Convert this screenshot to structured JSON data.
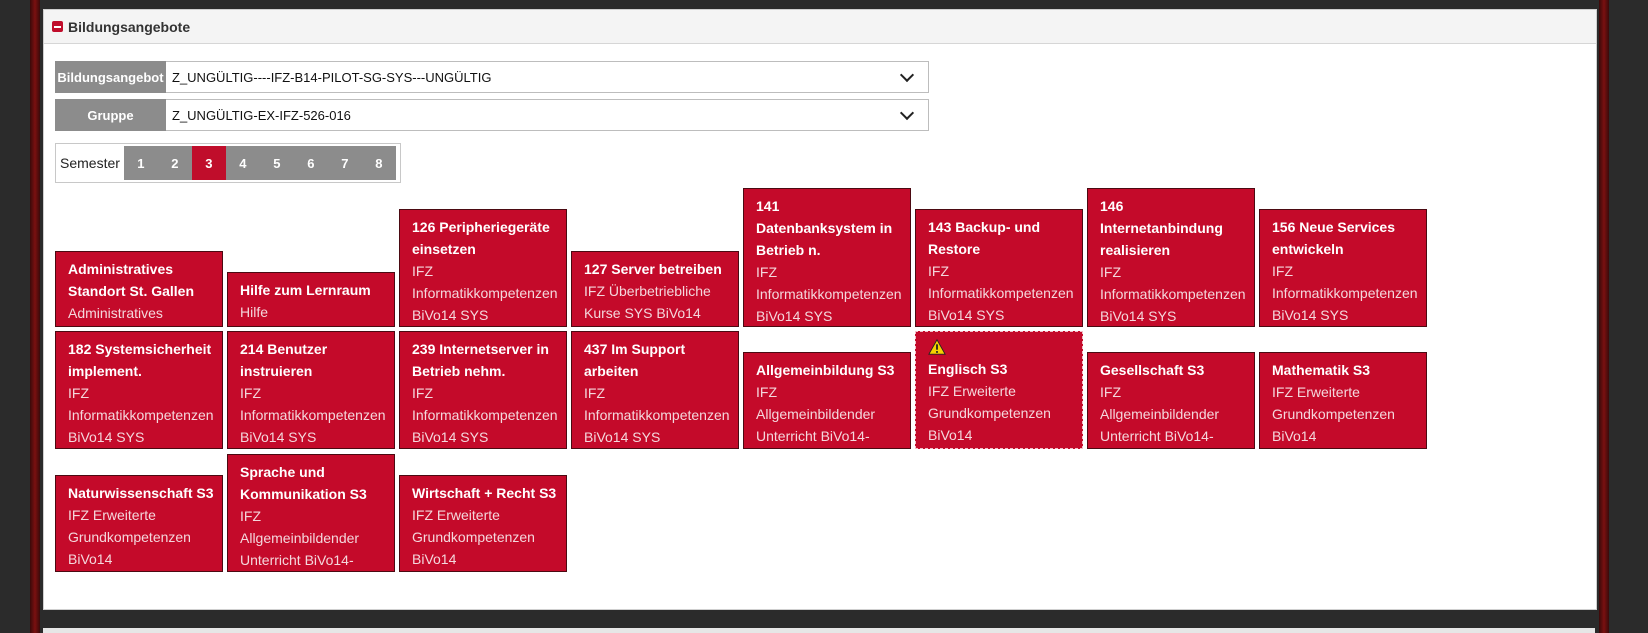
{
  "section": {
    "title": "Bildungsangebote"
  },
  "fields": {
    "bildungsangebot": {
      "label": "Bildungsangebot",
      "value": "Z_UNGÜLTIG----IFZ-B14-PILOT-SG-SYS---UNGÜLTIG"
    },
    "gruppe": {
      "label": "Gruppe",
      "value": "Z_UNGÜLTIG-EX-IFZ-526-016"
    }
  },
  "semester": {
    "label": "Semester",
    "options": [
      "1",
      "2",
      "3",
      "4",
      "5",
      "6",
      "7",
      "8"
    ],
    "active": "3"
  },
  "tiles": [
    {
      "title": "Administratives\nStandort St. Gallen",
      "sub": "Administratives"
    },
    {
      "title": "Hilfe zum Lernraum",
      "sub": "Hilfe"
    },
    {
      "title": "126 Peripheriegeräte\neinsetzen",
      "sub": "IFZ\nInformatikkompetenzen\nBiVo14 SYS"
    },
    {
      "title": "127 Server betreiben",
      "sub": "IFZ Überbetriebliche\nKurse SYS BiVo14"
    },
    {
      "title": "141\nDatenbanksystem in\nBetrieb n.",
      "sub": "IFZ\nInformatikkompetenzen\nBiVo14 SYS"
    },
    {
      "title": "143 Backup- und\nRestore",
      "sub": "IFZ\nInformatikkompetenzen\nBiVo14 SYS"
    },
    {
      "title": "146\nInternetanbindung\nrealisieren",
      "sub": "IFZ\nInformatikkompetenzen\nBiVo14 SYS"
    },
    {
      "title": "156 Neue Services\nentwickeln",
      "sub": "IFZ\nInformatikkompetenzen\nBiVo14 SYS"
    },
    {
      "title": "182 Systemsicherheit\nimplement.",
      "sub": "IFZ\nInformatikkompetenzen\nBiVo14 SYS"
    },
    {
      "title": "214 Benutzer\ninstruieren",
      "sub": "IFZ\nInformatikkompetenzen\nBiVo14 SYS"
    },
    {
      "title": "239 Internetserver in\nBetrieb nehm.",
      "sub": "IFZ\nInformatikkompetenzen\nBiVo14 SYS"
    },
    {
      "title": "437 Im Support\narbeiten",
      "sub": "IFZ\nInformatikkompetenzen\nBiVo14 SYS"
    },
    {
      "title": "Allgemeinbildung S3",
      "sub": "IFZ\nAllgemeinbildender\nUnterricht BiVo14-"
    },
    {
      "title": "Englisch S3",
      "sub": "IFZ Erweiterte\nGrundkompetenzen\nBiVo14",
      "warning": true
    },
    {
      "title": "Gesellschaft S3",
      "sub": "IFZ\nAllgemeinbildender\nUnterricht BiVo14-"
    },
    {
      "title": "Mathematik S3",
      "sub": "IFZ Erweiterte\nGrundkompetenzen\nBiVo14"
    },
    {
      "title": "Naturwissenschaft S3",
      "sub": "IFZ Erweiterte\nGrundkompetenzen\nBiVo14"
    },
    {
      "title": "Sprache und\nKommunikation S3",
      "sub": "IFZ\nAllgemeinbildender\nUnterricht BiVo14-"
    },
    {
      "title": "Wirtschaft + Recht S3",
      "sub": "IFZ Erweiterte\nGrundkompetenzen\nBiVo14"
    }
  ],
  "colors": {
    "tile_red": "#c40a2a",
    "active_semester": "#c00d2b",
    "label_gray": "#8c8c8c"
  },
  "icons": {
    "collapse": "minus-square-icon",
    "dropdown": "chevron-down-icon",
    "warning": "warning-triangle-icon"
  }
}
